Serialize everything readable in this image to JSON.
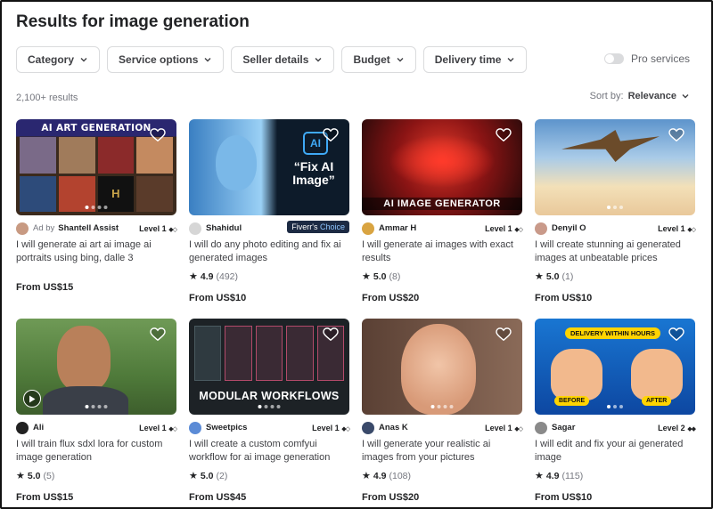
{
  "header": {
    "title_prefix": "Results for ",
    "title_query": "image generation"
  },
  "filters": [
    {
      "label": "Category"
    },
    {
      "label": "Service options"
    },
    {
      "label": "Seller details"
    },
    {
      "label": "Budget"
    },
    {
      "label": "Delivery time"
    }
  ],
  "pro_services": {
    "label": "Pro services",
    "enabled": false
  },
  "results": {
    "count": "2,100+ results"
  },
  "sort": {
    "label": "Sort by:",
    "value": "Relevance"
  },
  "gigs": [
    {
      "thumb_text": "AI ART GENERATION",
      "ad_label": "Ad by",
      "seller": "Shantell Assist",
      "level": "Level 1",
      "level_marks": "◆◇",
      "title": "I will generate ai art ai image ai portraits using bing, dalle 3",
      "rating": "",
      "reviews": "",
      "price": "From US$15",
      "colors": [
        "#2a2770",
        "#c9a54a"
      ]
    },
    {
      "thumb_text": "“Fix AI Image”",
      "thumb_sub": "AI",
      "ad_label": "",
      "seller": "Shahidul",
      "level": "",
      "level_marks": "",
      "badge": "Fiverr's",
      "badge_em": "Choice",
      "title": "I will do any photo editing and fix ai generated images",
      "rating": "4.9",
      "reviews": "(492)",
      "price": "From US$10",
      "colors": [
        "#0d1b2a",
        "#3fa9f5"
      ]
    },
    {
      "thumb_text": "AI IMAGE GENERATOR",
      "ad_label": "",
      "seller": "Ammar H",
      "level": "Level 1",
      "level_marks": "◆◇",
      "title": "I will generate ai images with exact results",
      "rating": "5.0",
      "reviews": "(8)",
      "price": "From US$20",
      "colors": [
        "#2b0a0a",
        "#d32020"
      ]
    },
    {
      "thumb_text": "",
      "ad_label": "",
      "seller": "Denyil O",
      "level": "Level 1",
      "level_marks": "◆◇",
      "title": "I will create stunning ai generated images at unbeatable prices",
      "rating": "5.0",
      "reviews": "(1)",
      "price": "From US$10",
      "colors": [
        "#6fa8dc",
        "#f3d9a4"
      ]
    },
    {
      "thumb_text": "",
      "ad_label": "",
      "seller": "Ali",
      "level": "Level 1",
      "level_marks": "◆◇",
      "title": "I will train flux sdxl lora for custom image generation",
      "rating": "5.0",
      "reviews": "(5)",
      "price": "From US$15",
      "colors": [
        "#4f7a3a",
        "#c98e5e"
      ]
    },
    {
      "thumb_text": "MODULAR WORKFLOWS",
      "ad_label": "",
      "seller": "Sweetpics",
      "level": "Level 1",
      "level_marks": "◆◇",
      "title": "I will create a custom comfyui workflow for ai image generation",
      "rating": "5.0",
      "reviews": "(2)",
      "price": "From US$45",
      "colors": [
        "#1d2226",
        "#b34a6a"
      ]
    },
    {
      "thumb_text": "",
      "ad_label": "",
      "seller": "Anas K",
      "level": "Level 1",
      "level_marks": "◆◇",
      "title": "I will generate your realistic ai images from your pictures",
      "rating": "4.9",
      "reviews": "(108)",
      "price": "From US$20",
      "colors": [
        "#7a5a48",
        "#e8b898"
      ]
    },
    {
      "thumb_text": "DELIVERY WITHIN HOURS",
      "thumb_before": "BEFORE",
      "thumb_after": "AFTER",
      "ad_label": "",
      "seller": "Sagar",
      "level": "Level 2",
      "level_marks": "◆◆",
      "title": "I will edit and fix your ai generated image",
      "rating": "4.9",
      "reviews": "(115)",
      "price": "From US$10",
      "colors": [
        "#1565c0",
        "#f2b98d"
      ]
    }
  ]
}
